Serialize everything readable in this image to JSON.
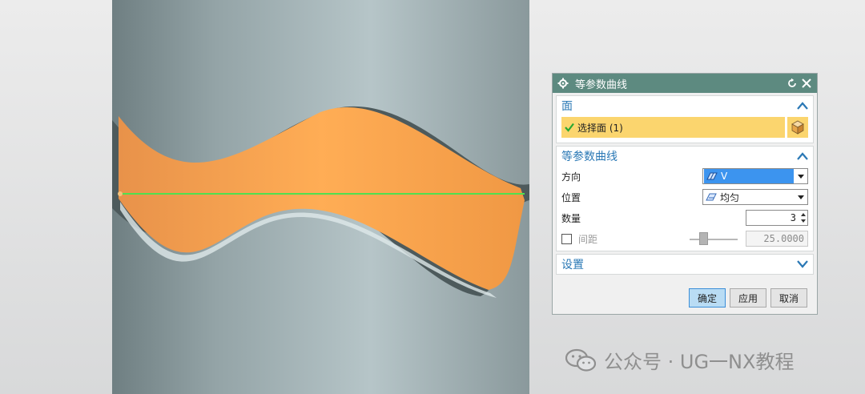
{
  "colors": {
    "titlebar": "#5d8a80",
    "accent": "#2a78b5",
    "selection": "#fbd56e",
    "surface_orange": "#f7a14f",
    "cylinder": "#9eaeb1",
    "iso_curve": "#4fe04f"
  },
  "dialog": {
    "title": "等参数曲线",
    "title_icon": "gear-icon",
    "reset_icon": "reset-icon",
    "close_icon": "close-icon",
    "face_section": {
      "label": "面",
      "expanded": true,
      "select_label": "选择面 (1)",
      "select_icon": "check-icon",
      "pick_icon": "cube-icon"
    },
    "curve_section": {
      "label": "等参数曲线",
      "expanded": true,
      "direction": {
        "label": "方向",
        "value": "V",
        "icon": "iso-direction-icon"
      },
      "position": {
        "label": "位置",
        "value": "均匀",
        "icon": "iso-position-icon"
      },
      "count": {
        "label": "数量",
        "value": "3"
      },
      "spacing": {
        "label": "间距",
        "checked": false,
        "value": "25.0000",
        "enabled": false
      }
    },
    "settings_section": {
      "label": "设置",
      "expanded": false
    },
    "buttons": {
      "ok": "确定",
      "apply": "应用",
      "cancel": "取消"
    }
  },
  "watermark": {
    "text": "公众号 · UG一NX教程",
    "icon": "wechat-icon"
  }
}
